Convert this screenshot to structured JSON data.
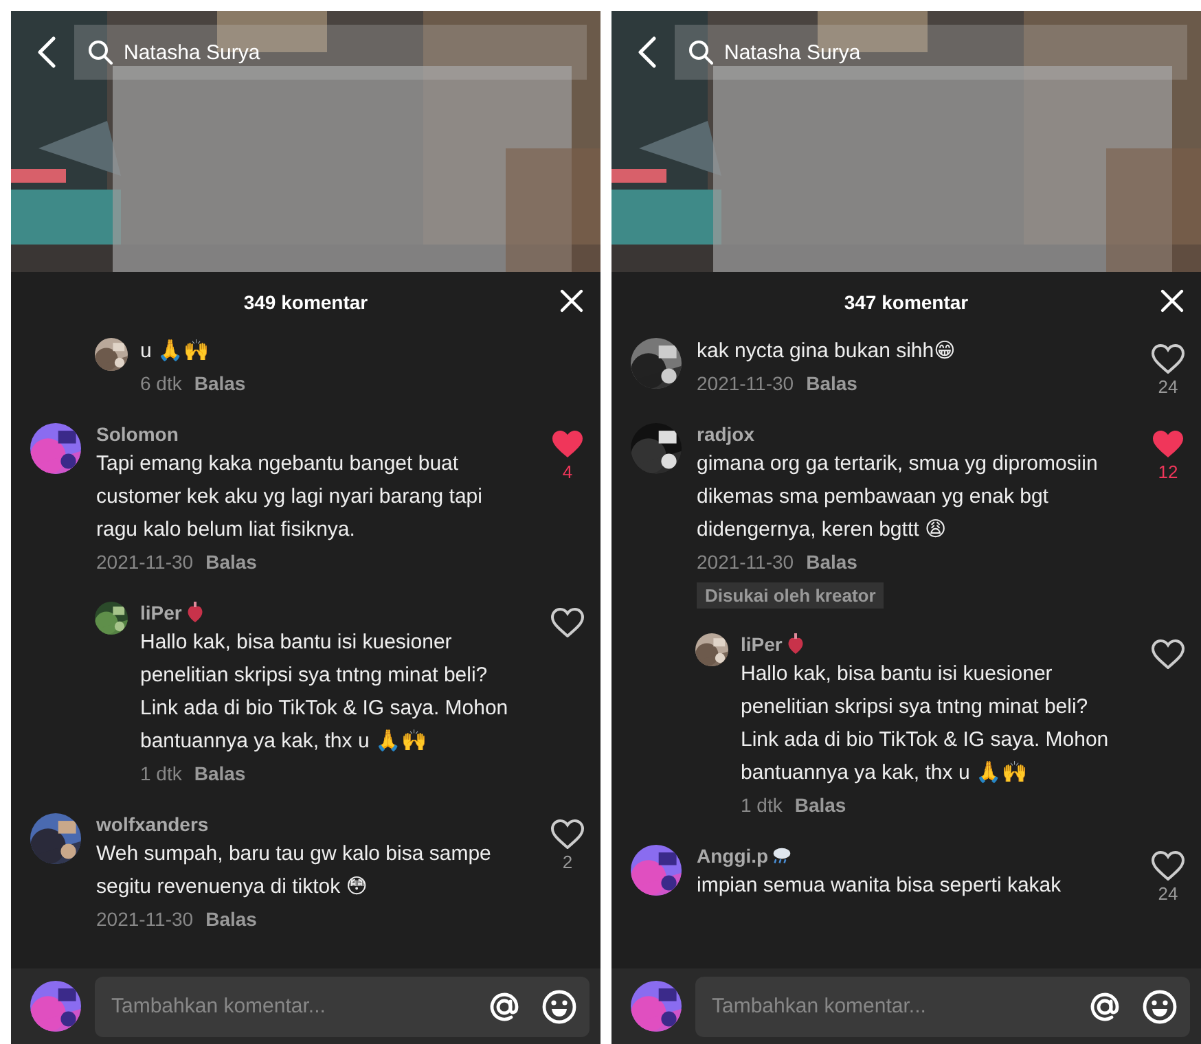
{
  "panels": [
    {
      "search": {
        "value": "Natasha Surya"
      },
      "comment_count": "349 komentar",
      "comments": [
        {
          "kind": "reply",
          "text": "u 🙏🙌",
          "time": "6 dtk",
          "reply_label": "Balas"
        },
        {
          "kind": "comment",
          "user": "Solomon",
          "text": "Tapi emang kaka ngebantu banget buat customer kek aku yg lagi nyari barang tapi ragu kalo belum liat fisiknya.",
          "time": "2021-11-30",
          "reply_label": "Balas",
          "liked": true,
          "like_count": "4"
        },
        {
          "kind": "reply",
          "user": "liPer",
          "user_badge": {
            "kind": "heart"
          },
          "text": "Hallo kak, bisa bantu isi kuesioner penelitian skripsi sya tntng minat beli? Link ada di bio TikTok & IG saya. Mohon bantuannya ya kak, thx u 🙏🙌",
          "time": "1 dtk",
          "reply_label": "Balas",
          "liked": false
        },
        {
          "kind": "comment",
          "user": "wolfxanders",
          "text": "Weh sumpah, baru tau gw kalo bisa sampe segitu revenuenya di tiktok 😳",
          "time": "2021-11-30",
          "reply_label": "Balas",
          "liked": false,
          "like_count": "2"
        }
      ],
      "composer": {
        "placeholder": "Tambahkan komentar..."
      }
    },
    {
      "search": {
        "value": "Natasha Surya"
      },
      "comment_count": "347 komentar",
      "comments": [
        {
          "kind": "comment",
          "text": "kak nycta gina bukan sihh😁",
          "time": "2021-11-30",
          "reply_label": "Balas",
          "liked": false,
          "like_count": "24"
        },
        {
          "kind": "comment",
          "user": "radjox",
          "text": "gimana org ga tertarik, smua yg dipromosiin dikemas sma pembawaan yg enak bgt didengernya, keren bgttt 😩",
          "time": "2021-11-30",
          "reply_label": "Balas",
          "liked": true,
          "like_count": "12",
          "creator_tag": "Disukai oleh kreator"
        },
        {
          "kind": "reply",
          "user": "liPer",
          "user_badge": {
            "kind": "heart"
          },
          "text": "Hallo kak, bisa bantu isi kuesioner penelitian skripsi sya tntng minat beli? Link ada di bio TikTok & IG saya. Mohon bantuannya ya kak, thx u 🙏🙌",
          "time": "1 dtk",
          "reply_label": "Balas",
          "liked": false
        },
        {
          "kind": "comment",
          "user": "Anggi.p",
          "user_badge": {
            "kind": "cloud"
          },
          "text": "impian semua wanita bisa seperti kakak",
          "liked": false,
          "like_count": "24"
        }
      ],
      "composer": {
        "placeholder": "Tambahkan komentar..."
      }
    }
  ]
}
